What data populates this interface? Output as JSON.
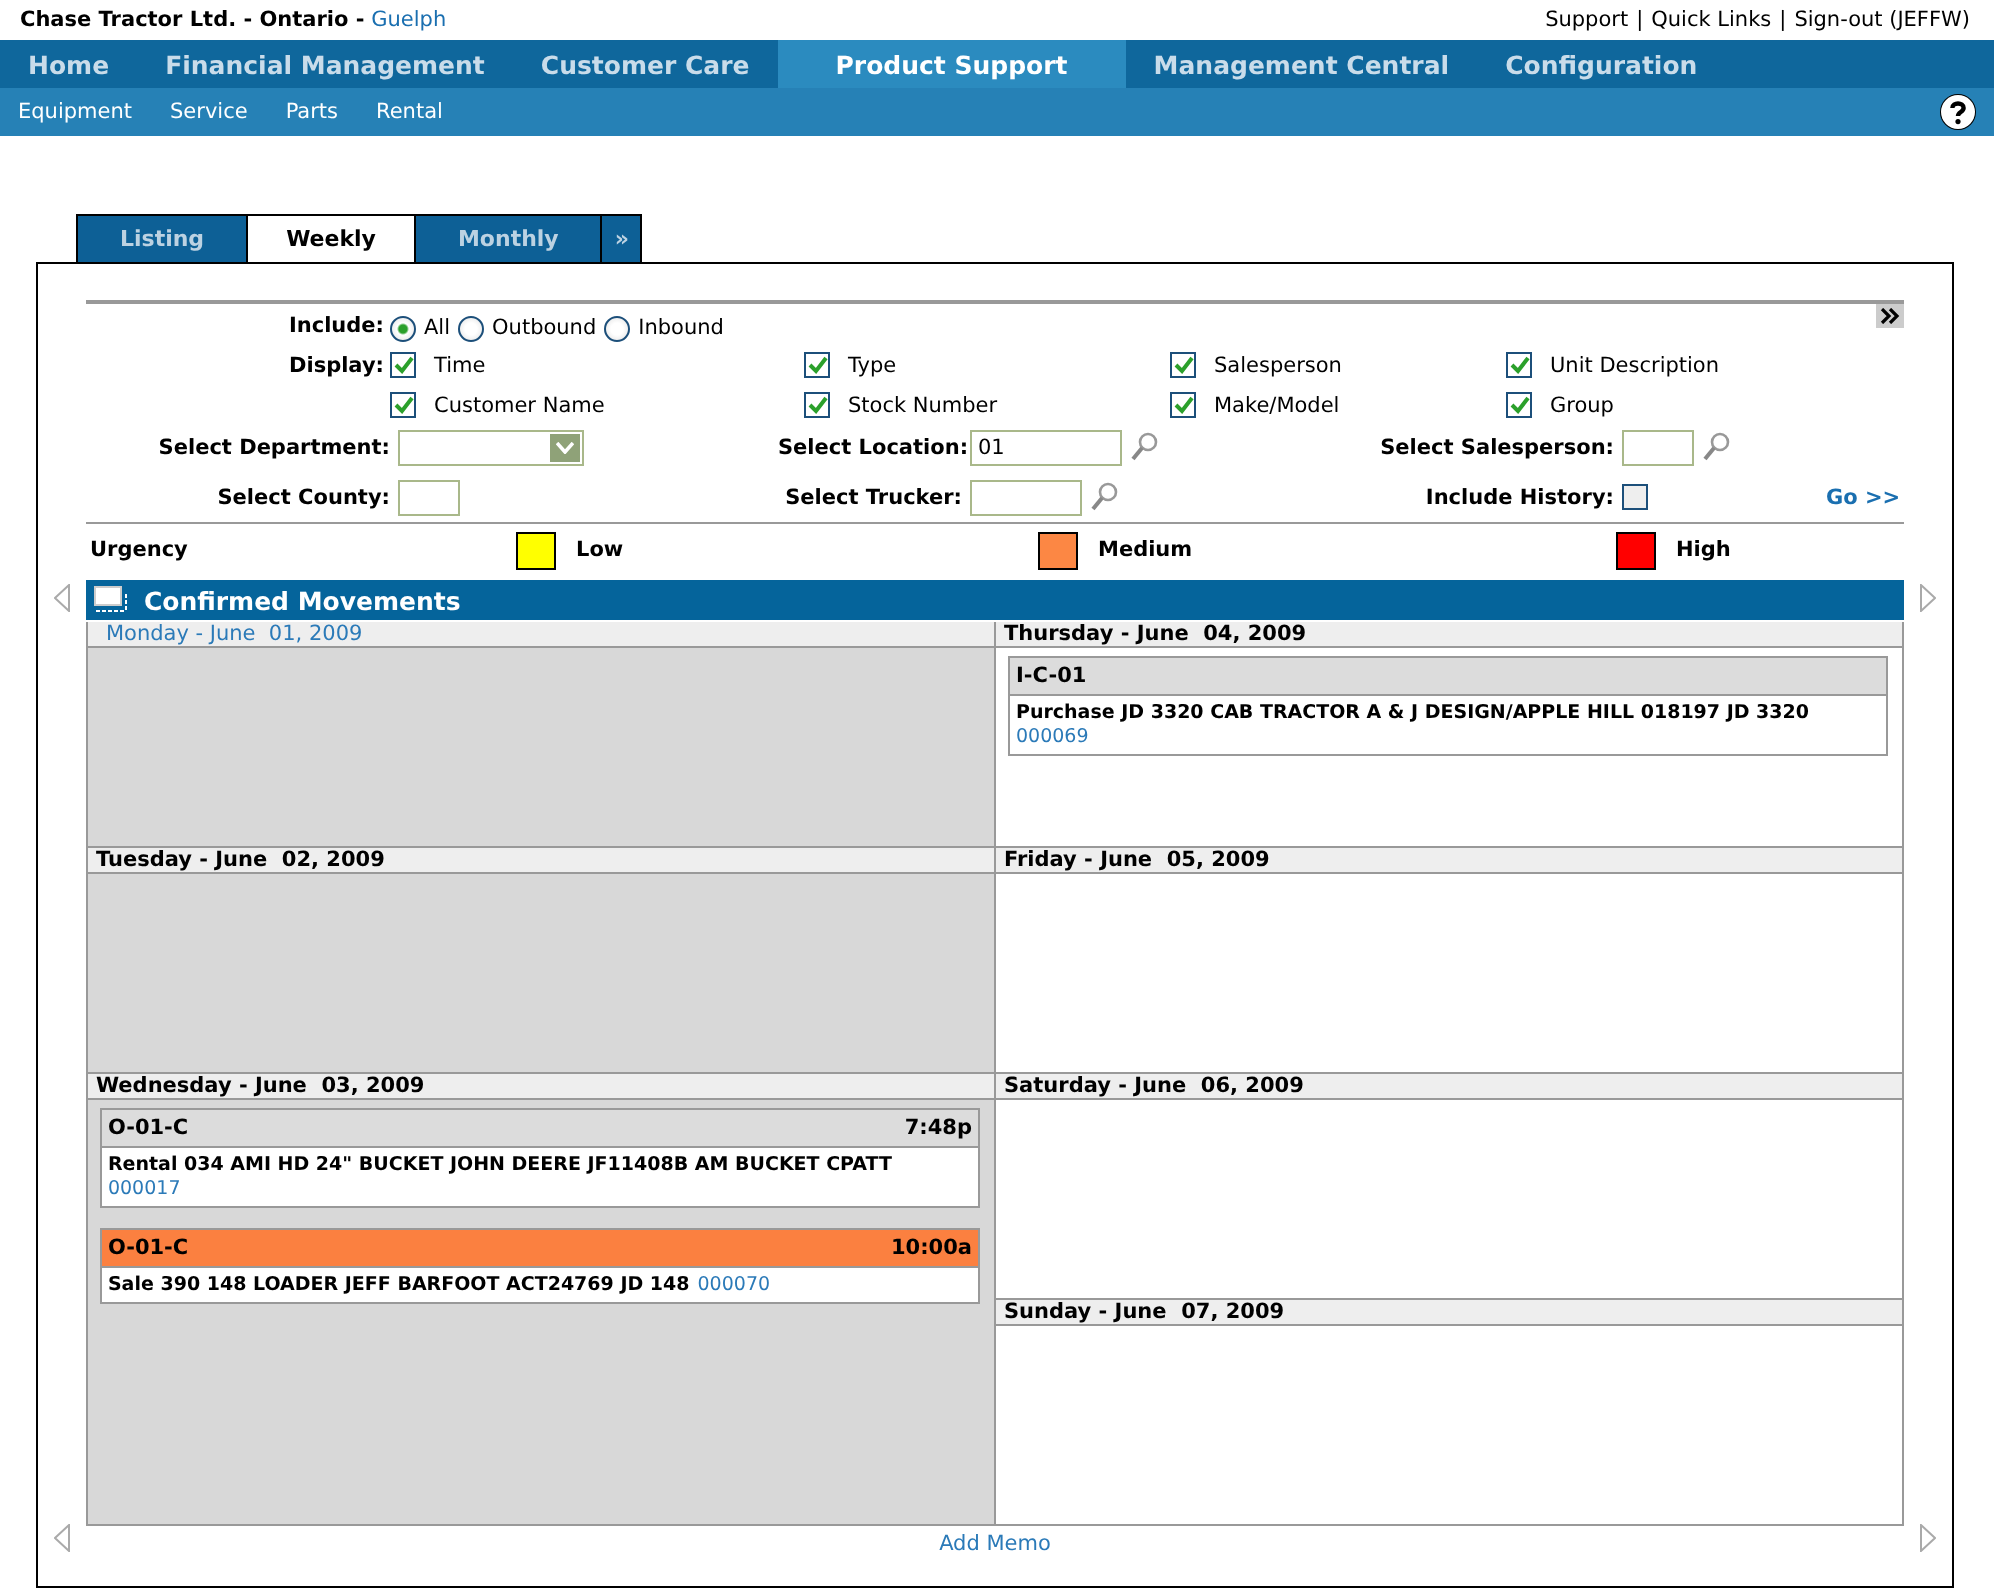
{
  "header": {
    "company": "Chase Tractor Ltd. - Ontario -",
    "location": "Guelph",
    "links": [
      "Support",
      "Quick Links",
      "Sign-out (JEFFW)"
    ],
    "separator": "|"
  },
  "nav": [
    {
      "label": "Home",
      "selected": false
    },
    {
      "label": "Financial Management",
      "selected": false
    },
    {
      "label": "Customer Care",
      "selected": false
    },
    {
      "label": "Product Support",
      "selected": true
    },
    {
      "label": "Management Central",
      "selected": false
    },
    {
      "label": "Configuration",
      "selected": false
    }
  ],
  "subnav": [
    "Equipment",
    "Service",
    "Parts",
    "Rental"
  ],
  "tabs": [
    {
      "label": "Listing",
      "selected": false
    },
    {
      "label": "Weekly",
      "selected": true
    },
    {
      "label": "Monthly",
      "selected": false
    },
    {
      "label": "»",
      "selected": false
    }
  ],
  "filters": {
    "include_label": "Include:",
    "include": [
      {
        "label": "All",
        "selected": true
      },
      {
        "label": "Outbound",
        "selected": false
      },
      {
        "label": "Inbound",
        "selected": false
      }
    ],
    "display_label": "Display:",
    "display": [
      {
        "label": "Time",
        "checked": true
      },
      {
        "label": "Type",
        "checked": true
      },
      {
        "label": "Salesperson",
        "checked": true
      },
      {
        "label": "Unit Description",
        "checked": true
      },
      {
        "label": "Customer Name",
        "checked": true
      },
      {
        "label": "Stock Number",
        "checked": true
      },
      {
        "label": "Make/Model",
        "checked": true
      },
      {
        "label": "Group",
        "checked": true
      }
    ],
    "department_label": "Select Department:",
    "location_label": "Select Location:",
    "location_value": "01",
    "salesperson_label": "Select Salesperson:",
    "county_label": "Select County:",
    "trucker_label": "Select Trucker:",
    "history_label": "Include History:",
    "history_checked": false,
    "go": "Go >>"
  },
  "urgency": {
    "label": "Urgency",
    "levels": [
      {
        "label": "Low",
        "color": "#ffff00"
      },
      {
        "label": "Medium",
        "color": "#fc8744"
      },
      {
        "label": "High",
        "color": "#ff0000"
      }
    ]
  },
  "calendar": {
    "title": "Confirmed Movements",
    "columns": [
      [
        {
          "day": "Monday - June  01, 2009",
          "today": true,
          "shaded": true
        },
        {
          "day": "Tuesday - June  02, 2009",
          "today": false,
          "shaded": true
        },
        {
          "day": "Wednesday - June  03, 2009",
          "today": false,
          "shaded": true,
          "events": [
            {
              "code": "O-01-C",
              "time": "7:48p",
              "urgent": false,
              "text": "Rental 034 AMI HD 24\" BUCKET JOHN DEERE JF11408B AM BUCKET CPATT",
              "number": "000017"
            },
            {
              "code": "O-01-C",
              "time": "10:00a",
              "urgent": true,
              "text": "Sale 390 148 LOADER JEFF BARFOOT ACT24769 JD 148",
              "number": "000070"
            }
          ]
        }
      ],
      [
        {
          "day": "Thursday - June  04, 2009",
          "today": false,
          "shaded": false,
          "events": [
            {
              "code": "I-C-01",
              "urgent": false,
              "text": "Purchase JD 3320 CAB TRACTOR A & J DESIGN/APPLE HILL 018197 JD 3320",
              "number": "000069"
            }
          ]
        },
        {
          "day": "Friday - June  05, 2009",
          "today": false,
          "shaded": false
        },
        {
          "day": "Saturday - June  06, 2009",
          "today": false,
          "shaded": false
        },
        {
          "day": "Sunday - June  07, 2009",
          "today": false,
          "shaded": false
        }
      ]
    ]
  },
  "add_memo": "Add Memo"
}
